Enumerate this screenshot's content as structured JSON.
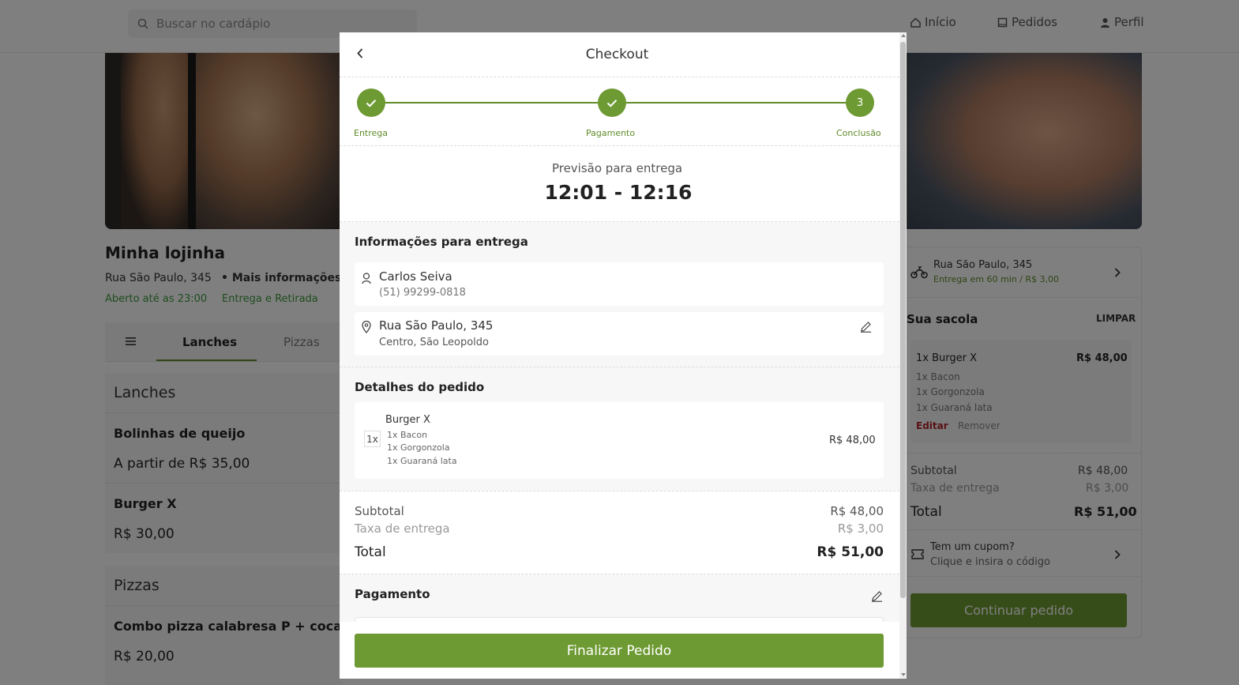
{
  "header": {
    "search_placeholder": "Buscar no cardápio",
    "nav": {
      "home": "Início",
      "orders": "Pedidos",
      "profile": "Perfil"
    }
  },
  "store": {
    "name": "Minha lojinha",
    "address": "Rua São Paulo, 345",
    "more_info": "• Mais informações",
    "open_until": "Aberto até as 23:00",
    "delivery_mode": "Entrega e Retirada"
  },
  "menu": {
    "tabs": [
      "Lanches",
      "Pizzas"
    ],
    "categories": [
      {
        "title": "Lanches",
        "items": [
          {
            "name": "Bolinhas de queijo",
            "price": "A partir de R$ 35,00"
          },
          {
            "name": "Burger X",
            "price": "R$ 30,00"
          }
        ]
      },
      {
        "title": "Pizzas",
        "items": [
          {
            "name": "Combo pizza calabresa P + coca-cola",
            "price": "R$ 20,00"
          }
        ]
      }
    ]
  },
  "sidebar": {
    "delivery_address": "Rua São Paulo, 345",
    "delivery_info": "Entrega em 60 min / R$ 3,00",
    "bag_title": "Sua sacola",
    "clear_label": "LIMPAR",
    "bag_item": {
      "name": "1x Burger X",
      "price": "R$ 48,00",
      "extras": [
        "1x Bacon",
        "1x Gorgonzola",
        "1x Guaraná lata"
      ],
      "edit": "Editar",
      "remove": "Remover"
    },
    "subtotal_label": "Subtotal",
    "subtotal": "R$ 48,00",
    "fee_label": "Taxa de entrega",
    "fee": "R$ 3,00",
    "total_label": "Total",
    "total": "R$ 51,00",
    "coupon_title": "Tem um cupom?",
    "coupon_sub": "Clique e insira o código",
    "continue_label": "Continuar pedido"
  },
  "checkout": {
    "title": "Checkout",
    "steps": [
      {
        "label": "Entrega",
        "status": "done"
      },
      {
        "label": "Pagamento",
        "status": "done"
      },
      {
        "label": "Conclusão",
        "number": "3",
        "status": "current"
      }
    ],
    "forecast_label": "Previsão para entrega",
    "forecast_time": "12:01 - 12:16",
    "delivery_section_title": "Informações para entrega",
    "customer_name": "Carlos Seiva",
    "customer_phone": "(51) 99299-0818",
    "address_line1": "Rua São Paulo, 345",
    "address_line2": "Centro, São Leopoldo",
    "order_section_title": "Detalhes do pedido",
    "order_item": {
      "qty": "1x",
      "name": "Burger X",
      "extras": [
        "1x Bacon",
        "1x Gorgonzola",
        "1x Guaraná lata"
      ],
      "price": "R$ 48,00"
    },
    "subtotal_label": "Subtotal",
    "subtotal": "R$ 48,00",
    "fee_label": "Taxa de entrega",
    "fee": "R$ 3,00",
    "total_label": "Total",
    "total": "R$ 51,00",
    "payment_title": "Pagamento",
    "finish_label": "Finalizar Pedido"
  },
  "colors": {
    "brand_green": "#6e9a33",
    "open_green": "#3f9a3f",
    "edit_red": "#b2222a"
  }
}
